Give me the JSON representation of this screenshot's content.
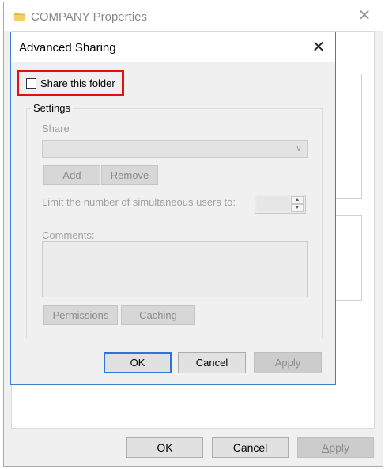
{
  "parent_window": {
    "title": "COMPANY Properties",
    "icon": "folder-icon",
    "close_glyph": "✕",
    "buttons": {
      "ok": "OK",
      "cancel": "Cancel",
      "apply": "Apply"
    }
  },
  "dialog": {
    "title": "Advanced Sharing",
    "close_glyph": "✕",
    "share_checkbox": {
      "label": "Share this folder",
      "checked": false
    },
    "settings": {
      "legend": "Settings",
      "share_label": "Share",
      "share_value": "",
      "add_label": "Add",
      "remove_label": "Remove",
      "limit_label": "Limit the number of simultaneous users to:",
      "limit_value": "",
      "comments_label": "Comments:",
      "comments_value": "",
      "permissions_label": "Permissions",
      "caching_label": "Caching"
    },
    "buttons": {
      "ok": "OK",
      "cancel": "Cancel",
      "apply": "Apply"
    }
  },
  "colors": {
    "highlight": "#e31010",
    "dialog_border": "#3c7fd0",
    "focus_border": "#2f74d6",
    "folder": "#e8b54a"
  }
}
